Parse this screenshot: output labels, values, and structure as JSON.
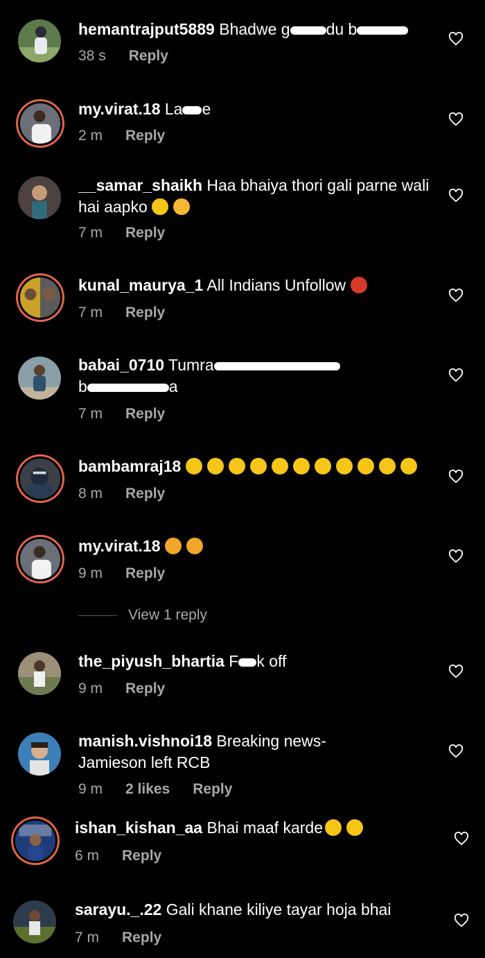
{
  "comments": [
    {
      "username": "hemantrajput5889",
      "text_start": "Bhadwe g",
      "text_end": "du b",
      "time": "38 s",
      "reply": "Reply"
    },
    {
      "username": "my.virat.18",
      "text_start": "La",
      "text_end": "e",
      "time": "2 m",
      "reply": "Reply"
    },
    {
      "username": "__samar_shaikh",
      "text": "Haa bhaiya thori gali parne wali hai aapko",
      "time": "7 m",
      "reply": "Reply"
    },
    {
      "username": "kunal_maurya_1",
      "text": "All Indians Unfollow",
      "time": "7 m",
      "reply": "Reply"
    },
    {
      "username": "babai_0710",
      "text_start": "Tumra",
      "text_line2_start": "b",
      "text_line2_end": "a",
      "time": "7 m",
      "reply": "Reply"
    },
    {
      "username": "bambamraj18",
      "text": "",
      "time": "8 m",
      "reply": "Reply"
    },
    {
      "username": "my.virat.18",
      "text": "",
      "time": "9 m",
      "reply": "Reply"
    },
    {
      "username": "the_piyush_bhartia",
      "text_start": "F",
      "text_end": "k off",
      "time": "9 m",
      "reply": "Reply"
    },
    {
      "username": "manish.vishnoi18",
      "text": "Breaking news- Jamieson left RCB",
      "time": "9 m",
      "likes": "2 likes",
      "reply": "Reply"
    },
    {
      "username": "ishan_kishan_aa",
      "text": "Bhai maaf karde",
      "time": "6 m",
      "reply": "Reply"
    },
    {
      "username": "sarayu._.22",
      "text": "Gali khane kiliye tayar hoja bhai",
      "time": "7 m",
      "reply": "Reply"
    }
  ],
  "view_replies": "View 1 reply",
  "icons": {
    "like": "heart-outline-icon"
  },
  "colors": {
    "background": "#000000",
    "story_ring": "#e3654a",
    "muted": "#a8a8a8"
  }
}
